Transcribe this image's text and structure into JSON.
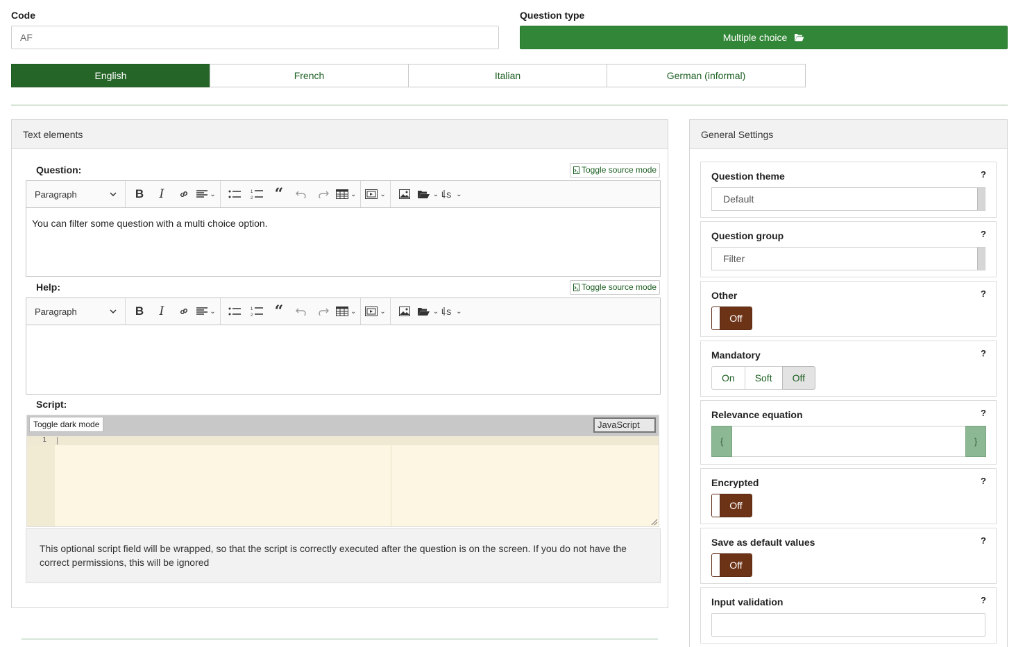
{
  "code": {
    "label": "Code",
    "value": "AF"
  },
  "question_type": {
    "label": "Question type",
    "button_label": "Multiple choice",
    "icon": "folder-open-icon"
  },
  "languages": [
    {
      "label": "English",
      "active": true
    },
    {
      "label": "French",
      "active": false
    },
    {
      "label": "Italian",
      "active": false
    },
    {
      "label": "German (informal)",
      "active": false
    }
  ],
  "text_elements": {
    "title": "Text elements",
    "question": {
      "label": "Question:",
      "toggle_source": "Toggle source mode",
      "format": "Paragraph",
      "content": "You can filter some question with a multi choice option."
    },
    "help": {
      "label": "Help:",
      "toggle_source": "Toggle source mode",
      "format": "Paragraph",
      "content": ""
    },
    "script": {
      "label": "Script:",
      "toggle_dark": "Toggle dark mode",
      "language": "JavaScript",
      "line_number": "1",
      "note": "This optional script field will be wrapped, so that the script is correctly executed after the question is on the screen. If you do not have the correct permissions, this will be ignored"
    }
  },
  "general_settings": {
    "title": "General Settings",
    "help_mark": "?",
    "question_theme": {
      "label": "Question theme",
      "value": "Default"
    },
    "question_group": {
      "label": "Question group",
      "value": "Filter"
    },
    "other": {
      "label": "Other",
      "state": "Off"
    },
    "mandatory": {
      "label": "Mandatory",
      "options": [
        "On",
        "Soft",
        "Off"
      ],
      "selected": "Off"
    },
    "relevance": {
      "label": "Relevance equation",
      "open": "{",
      "close": "}",
      "value": ""
    },
    "encrypted": {
      "label": "Encrypted",
      "state": "Off"
    },
    "save_default": {
      "label": "Save as default values",
      "state": "Off"
    },
    "input_validation": {
      "label": "Input validation",
      "value": ""
    }
  },
  "colors": {
    "primary_green": "#328637",
    "dark_green": "#256528",
    "switch_off": "#6d3317"
  }
}
